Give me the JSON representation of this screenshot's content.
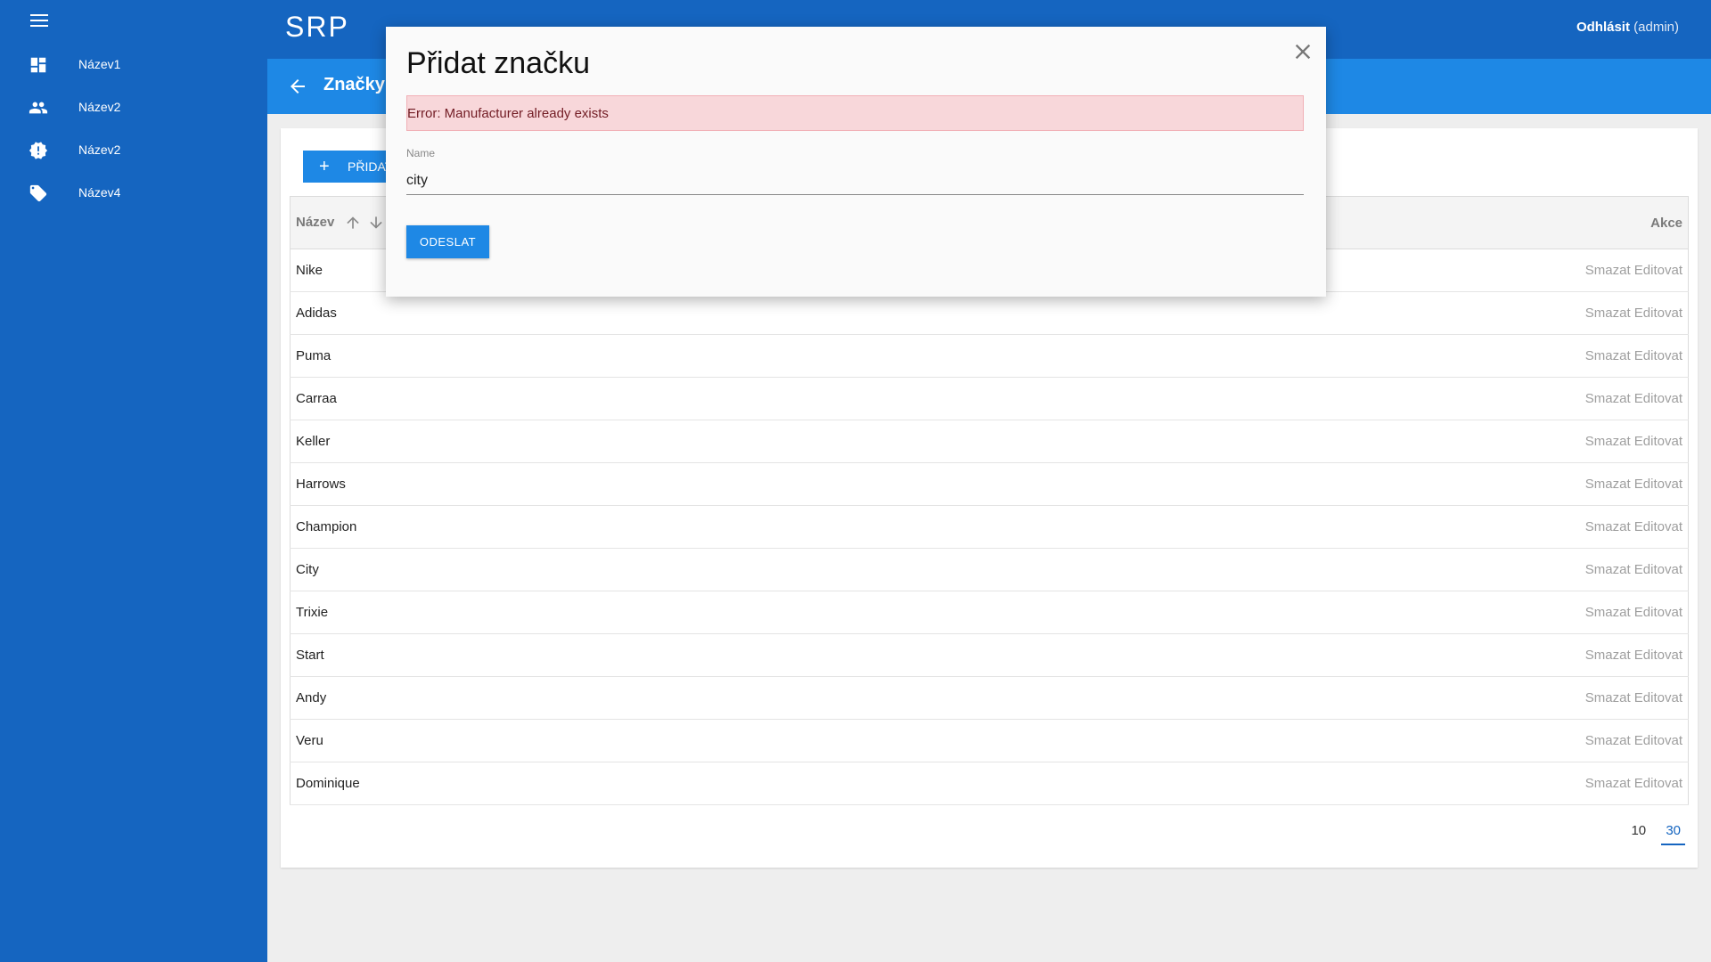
{
  "app": {
    "title": "SRP"
  },
  "header": {
    "logout_label": "Odhlásit",
    "user": "(admin)"
  },
  "sidebar": {
    "items": [
      {
        "label": "Název1",
        "icon": "dashboard-icon"
      },
      {
        "label": "Název2",
        "icon": "people-icon"
      },
      {
        "label": "Název2",
        "icon": "alert-badge-icon"
      },
      {
        "label": "Název4",
        "icon": "tag-icon"
      }
    ]
  },
  "page": {
    "title": "Značky",
    "add_button_label": "PŘIDAT"
  },
  "table": {
    "columns": {
      "name": "Název",
      "actions": "Akce"
    },
    "delete_label": "Smazat",
    "edit_label": "Editovat",
    "rows": [
      "Nike",
      "Adidas",
      "Puma",
      "Carraa",
      "Keller",
      "Harrows",
      "Champion",
      "City",
      "Trixie",
      "Start",
      "Andy",
      "Veru",
      "Dominique"
    ]
  },
  "pagination": {
    "options": [
      "10",
      "30"
    ],
    "active": "30"
  },
  "modal": {
    "title": "Přidat značku",
    "error": "Error: Manufacturer already exists",
    "field_label": "Name",
    "field_value": "city",
    "submit_label": "ODESLAT"
  },
  "colors": {
    "primary_dark": "#1565c0",
    "primary": "#1e88e5",
    "error_bg": "#f8d7da",
    "error_text": "#721c24"
  }
}
